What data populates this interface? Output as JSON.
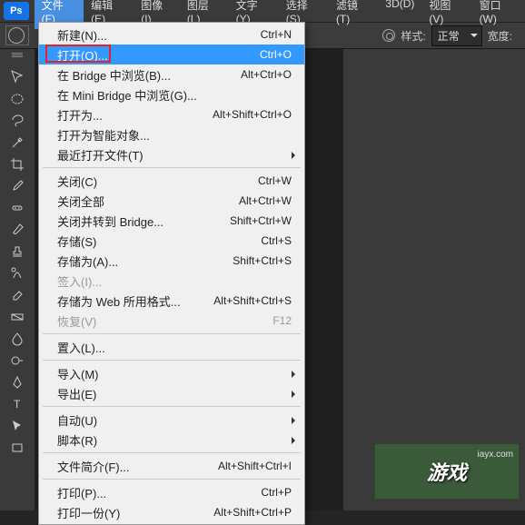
{
  "menubar": {
    "items": [
      {
        "label": "文件(F)",
        "active": true
      },
      {
        "label": "编辑(E)"
      },
      {
        "label": "图像(I)"
      },
      {
        "label": "图层(L)"
      },
      {
        "label": "文字(Y)"
      },
      {
        "label": "选择(S)"
      },
      {
        "label": "滤镜(T)"
      },
      {
        "label": "3D(D)"
      },
      {
        "label": "视图(V)"
      },
      {
        "label": "窗口(W)"
      }
    ],
    "logo": "Ps"
  },
  "optionsbar": {
    "style_label": "样式:",
    "style_value": "正常",
    "width_label": "宽度:"
  },
  "dropdown": {
    "items": [
      {
        "label": "新建(N)...",
        "shortcut": "Ctrl+N"
      },
      {
        "label": "打开(O)...",
        "shortcut": "Ctrl+O",
        "highlight": true
      },
      {
        "label": "在 Bridge 中浏览(B)...",
        "shortcut": "Alt+Ctrl+O"
      },
      {
        "label": "在 Mini Bridge 中浏览(G)..."
      },
      {
        "label": "打开为...",
        "shortcut": "Alt+Shift+Ctrl+O"
      },
      {
        "label": "打开为智能对象..."
      },
      {
        "label": "最近打开文件(T)",
        "sub": true
      },
      {
        "sep": true
      },
      {
        "label": "关闭(C)",
        "shortcut": "Ctrl+W"
      },
      {
        "label": "关闭全部",
        "shortcut": "Alt+Ctrl+W"
      },
      {
        "label": "关闭并转到 Bridge...",
        "shortcut": "Shift+Ctrl+W"
      },
      {
        "label": "存储(S)",
        "shortcut": "Ctrl+S"
      },
      {
        "label": "存储为(A)...",
        "shortcut": "Shift+Ctrl+S"
      },
      {
        "label": "签入(I)...",
        "disabled": true
      },
      {
        "label": "存储为 Web 所用格式...",
        "shortcut": "Alt+Shift+Ctrl+S"
      },
      {
        "label": "恢复(V)",
        "shortcut": "F12",
        "disabled": true
      },
      {
        "sep": true
      },
      {
        "label": "置入(L)..."
      },
      {
        "sep": true
      },
      {
        "label": "导入(M)",
        "sub": true
      },
      {
        "label": "导出(E)",
        "sub": true
      },
      {
        "sep": true
      },
      {
        "label": "自动(U)",
        "sub": true
      },
      {
        "label": "脚本(R)",
        "sub": true
      },
      {
        "sep": true
      },
      {
        "label": "文件简介(F)...",
        "shortcut": "Alt+Shift+Ctrl+I"
      },
      {
        "sep": true
      },
      {
        "label": "打印(P)...",
        "shortcut": "Ctrl+P"
      },
      {
        "label": "打印一份(Y)",
        "shortcut": "Alt+Shift+Ctrl+P"
      }
    ]
  },
  "watermark": {
    "main": "游戏",
    "sub": "iayx.com"
  }
}
